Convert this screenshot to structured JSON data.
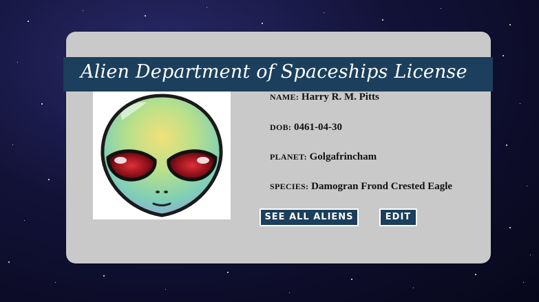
{
  "license": {
    "title": "Alien Department of Spaceships License",
    "name_label": "NAME:",
    "name_value": "Harry R. M. Pitts",
    "dob_label": "DOB:",
    "dob_value": "0461-04-30",
    "planet_label": "PLANET:",
    "planet_value": "Golgafrincham",
    "species_label": "SPECIES:",
    "species_value": "Damogran Frond Crested Eagle",
    "photo_icon": "alien-head-icon"
  },
  "actions": {
    "see_all_label": "SEE ALL ALIENS",
    "edit_label": "EDIT"
  },
  "colors": {
    "banner": "#1b3f5c",
    "card": "#c9c9c9",
    "button": "#1b3f5c"
  }
}
